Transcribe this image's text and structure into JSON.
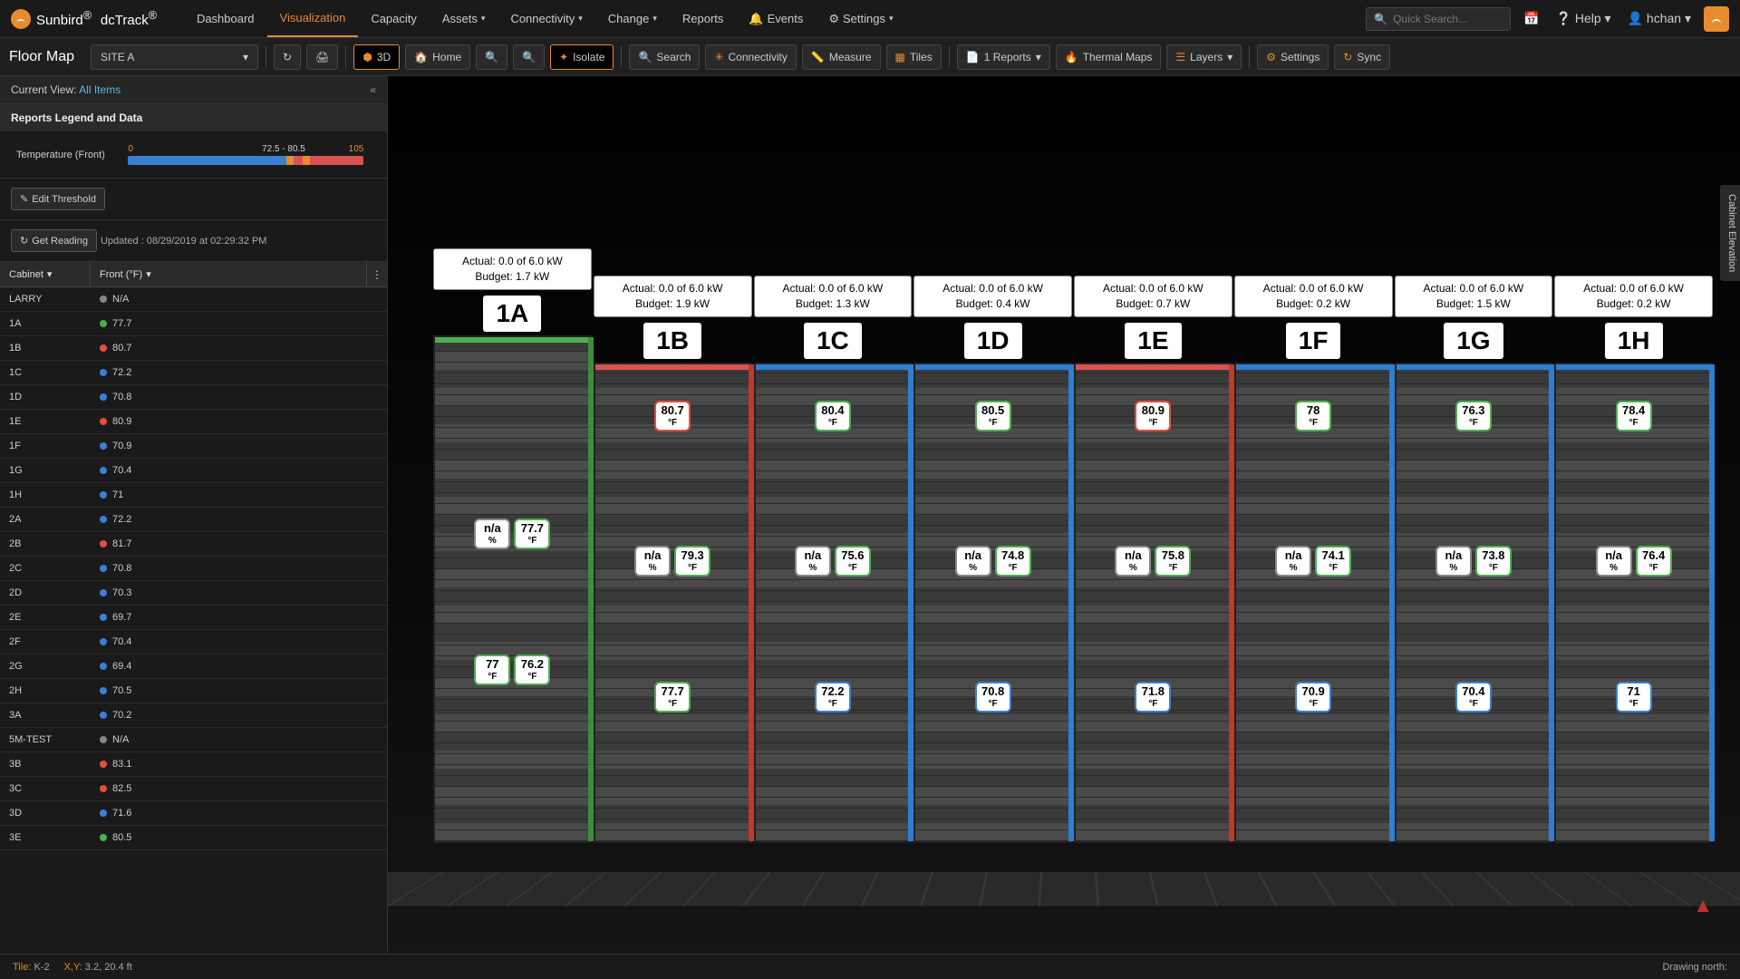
{
  "brand": {
    "name": "Sunbird",
    "product": "dcTrack",
    "reg": "®"
  },
  "nav": {
    "items": [
      "Dashboard",
      "Visualization",
      "Capacity",
      "Assets",
      "Connectivity",
      "Change",
      "Reports",
      "Events",
      "Settings"
    ],
    "has_caret": [
      false,
      false,
      false,
      true,
      true,
      true,
      false,
      false,
      true
    ],
    "active_index": 1,
    "events_icon": "bell"
  },
  "topright": {
    "search_placeholder": "Quick Search...",
    "help": "Help",
    "user": "hchan"
  },
  "toolbar": {
    "page_title": "Floor Map",
    "site": "SITE A",
    "buttons": {
      "refresh": "↻",
      "print": "🖨",
      "three_d": "3D",
      "home": "Home",
      "zoom_in": "⊕",
      "zoom_out": "⊖",
      "isolate": "Isolate",
      "search": "Search",
      "connectivity": "Connectivity",
      "measure": "Measure",
      "tiles": "Tiles",
      "reports": "1 Reports",
      "thermal": "Thermal Maps",
      "layers": "Layers",
      "settings": "Settings",
      "sync": "Sync"
    }
  },
  "sidebar": {
    "current_view_label": "Current View:",
    "current_view_value": "All Items",
    "legend_title": "Reports Legend and Data",
    "temp_label": "Temperature (Front)",
    "temp_min": "0",
    "temp_mid": "72.5 - 80.5",
    "temp_max": "105",
    "edit_threshold": "Edit Threshold",
    "get_reading": "Get Reading",
    "updated": "Updated : 08/29/2019 at 02:29:32 PM",
    "col_cabinet": "Cabinet",
    "col_front": "Front (°F)",
    "rows": [
      {
        "c": "LARRY",
        "v": "N/A",
        "dot": "gray"
      },
      {
        "c": "1A",
        "v": "77.7",
        "dot": "green"
      },
      {
        "c": "1B",
        "v": "80.7",
        "dot": "red"
      },
      {
        "c": "1C",
        "v": "72.2",
        "dot": "blue"
      },
      {
        "c": "1D",
        "v": "70.8",
        "dot": "blue"
      },
      {
        "c": "1E",
        "v": "80.9",
        "dot": "red"
      },
      {
        "c": "1F",
        "v": "70.9",
        "dot": "blue"
      },
      {
        "c": "1G",
        "v": "70.4",
        "dot": "blue"
      },
      {
        "c": "1H",
        "v": "71",
        "dot": "blue"
      },
      {
        "c": "2A",
        "v": "72.2",
        "dot": "blue"
      },
      {
        "c": "2B",
        "v": "81.7",
        "dot": "red"
      },
      {
        "c": "2C",
        "v": "70.8",
        "dot": "blue"
      },
      {
        "c": "2D",
        "v": "70.3",
        "dot": "blue"
      },
      {
        "c": "2E",
        "v": "69.7",
        "dot": "blue"
      },
      {
        "c": "2F",
        "v": "70.4",
        "dot": "blue"
      },
      {
        "c": "2G",
        "v": "69.4",
        "dot": "blue"
      },
      {
        "c": "2H",
        "v": "70.5",
        "dot": "blue"
      },
      {
        "c": "3A",
        "v": "70.2",
        "dot": "blue"
      },
      {
        "c": "5M-TEST",
        "v": "N/A",
        "dot": "gray"
      },
      {
        "c": "3B",
        "v": "83.1",
        "dot": "red"
      },
      {
        "c": "3C",
        "v": "82.5",
        "dot": "red"
      },
      {
        "c": "3D",
        "v": "71.6",
        "dot": "blue"
      },
      {
        "c": "3E",
        "v": "80.5",
        "dot": "green"
      }
    ]
  },
  "racks": [
    {
      "label": "1A",
      "actual": "Actual: 0.0 of 6.0 kW",
      "budget": "Budget: 1.7 kW",
      "top": "green",
      "side": "green",
      "big": true,
      "sensors": [
        {
          "pos": 200,
          "badges": [
            {
              "v": "n/a",
              "u": "%",
              "c": "gray"
            },
            {
              "v": "77.7",
              "u": "°F",
              "c": "green"
            }
          ]
        },
        {
          "pos": 350,
          "badges": [
            {
              "v": "77",
              "u": "°F",
              "c": "green"
            },
            {
              "v": "76.2",
              "u": "°F",
              "c": "green"
            }
          ]
        }
      ]
    },
    {
      "label": "1B",
      "actual": "Actual: 0.0 of 6.0 kW",
      "budget": "Budget: 1.9 kW",
      "top": "red",
      "side": "red",
      "sensors": [
        {
          "pos": 40,
          "badges": [
            {
              "v": "80.7",
              "u": "°F",
              "c": "red"
            }
          ]
        },
        {
          "pos": 200,
          "badges": [
            {
              "v": "n/a",
              "u": "%",
              "c": "gray"
            },
            {
              "v": "79.3",
              "u": "°F",
              "c": "green"
            }
          ]
        },
        {
          "pos": 350,
          "badges": [
            {
              "v": "77.7",
              "u": "°F",
              "c": "green"
            }
          ]
        }
      ]
    },
    {
      "label": "1C",
      "actual": "Actual: 0.0 of 6.0 kW",
      "budget": "Budget: 1.3 kW",
      "top": "blue",
      "side": "blue",
      "sensors": [
        {
          "pos": 40,
          "badges": [
            {
              "v": "80.4",
              "u": "°F",
              "c": "green"
            }
          ]
        },
        {
          "pos": 200,
          "badges": [
            {
              "v": "n/a",
              "u": "%",
              "c": "gray"
            },
            {
              "v": "75.6",
              "u": "°F",
              "c": "green"
            }
          ]
        },
        {
          "pos": 350,
          "badges": [
            {
              "v": "72.2",
              "u": "°F",
              "c": "blue"
            }
          ]
        }
      ]
    },
    {
      "label": "1D",
      "actual": "Actual: 0.0 of 6.0 kW",
      "budget": "Budget: 0.4 kW",
      "top": "blue",
      "side": "blue",
      "sensors": [
        {
          "pos": 40,
          "badges": [
            {
              "v": "80.5",
              "u": "°F",
              "c": "green"
            }
          ]
        },
        {
          "pos": 200,
          "badges": [
            {
              "v": "n/a",
              "u": "%",
              "c": "gray"
            },
            {
              "v": "74.8",
              "u": "°F",
              "c": "green"
            }
          ]
        },
        {
          "pos": 350,
          "badges": [
            {
              "v": "70.8",
              "u": "°F",
              "c": "blue"
            }
          ]
        }
      ]
    },
    {
      "label": "1E",
      "actual": "Actual: 0.0 of 6.0 kW",
      "budget": "Budget: 0.7 kW",
      "top": "red",
      "side": "red",
      "sensors": [
        {
          "pos": 40,
          "badges": [
            {
              "v": "80.9",
              "u": "°F",
              "c": "red"
            }
          ]
        },
        {
          "pos": 200,
          "badges": [
            {
              "v": "n/a",
              "u": "%",
              "c": "gray"
            },
            {
              "v": "75.8",
              "u": "°F",
              "c": "green"
            }
          ]
        },
        {
          "pos": 350,
          "badges": [
            {
              "v": "71.8",
              "u": "°F",
              "c": "blue"
            }
          ]
        }
      ]
    },
    {
      "label": "1F",
      "actual": "Actual: 0.0 of 6.0 kW",
      "budget": "Budget: 0.2 kW",
      "top": "blue",
      "side": "blue",
      "sensors": [
        {
          "pos": 40,
          "badges": [
            {
              "v": "78",
              "u": "°F",
              "c": "green"
            }
          ]
        },
        {
          "pos": 200,
          "badges": [
            {
              "v": "n/a",
              "u": "%",
              "c": "gray"
            },
            {
              "v": "74.1",
              "u": "°F",
              "c": "green"
            }
          ]
        },
        {
          "pos": 350,
          "badges": [
            {
              "v": "70.9",
              "u": "°F",
              "c": "blue"
            }
          ]
        }
      ]
    },
    {
      "label": "1G",
      "actual": "Actual: 0.0 of 6.0 kW",
      "budget": "Budget: 1.5 kW",
      "top": "blue",
      "side": "blue",
      "sensors": [
        {
          "pos": 40,
          "badges": [
            {
              "v": "76.3",
              "u": "°F",
              "c": "green"
            }
          ]
        },
        {
          "pos": 200,
          "badges": [
            {
              "v": "n/a",
              "u": "%",
              "c": "gray"
            },
            {
              "v": "73.8",
              "u": "°F",
              "c": "green"
            }
          ]
        },
        {
          "pos": 350,
          "badges": [
            {
              "v": "70.4",
              "u": "°F",
              "c": "blue"
            }
          ]
        }
      ]
    },
    {
      "label": "1H",
      "actual": "Actual: 0.0 of 6.0 kW",
      "budget": "Budget: 0.2 kW",
      "top": "blue",
      "side": "blue",
      "sensors": [
        {
          "pos": 40,
          "badges": [
            {
              "v": "78.4",
              "u": "°F",
              "c": "green"
            }
          ]
        },
        {
          "pos": 200,
          "badges": [
            {
              "v": "n/a",
              "u": "%",
              "c": "gray"
            },
            {
              "v": "76.4",
              "u": "°F",
              "c": "green"
            }
          ]
        },
        {
          "pos": 350,
          "badges": [
            {
              "v": "71",
              "u": "°F",
              "c": "blue"
            }
          ]
        }
      ]
    }
  ],
  "right_tab": "Cabinet Elevation",
  "status": {
    "tile_label": "Tile:",
    "tile": "K-2",
    "xy_label": "X,Y:",
    "xy": "3.2, 20.4 ft",
    "drawing": "Drawing north:"
  }
}
